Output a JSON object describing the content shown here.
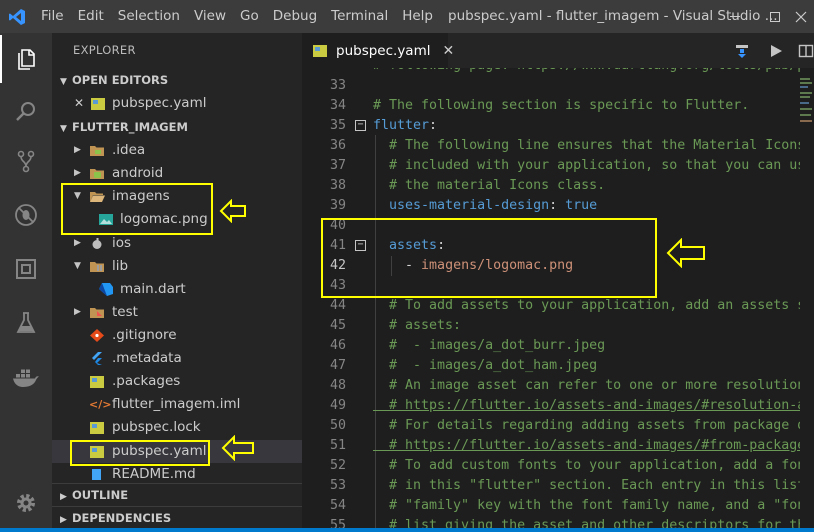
{
  "window": {
    "title": "pubspec.yaml - flutter_imagem - Visual Studio ...",
    "menu": [
      "File",
      "Edit",
      "Selection",
      "View",
      "Go",
      "Debug",
      "Terminal",
      "Help"
    ]
  },
  "activity_bar": [
    "explorer-icon",
    "search-icon",
    "source-control-icon",
    "debug-icon",
    "extensions-icon",
    "test-icon",
    "docker-icon",
    "gear-icon"
  ],
  "sidebar": {
    "title": "EXPLORER",
    "open_editors": {
      "header": "OPEN EDITORS",
      "items": [
        {
          "label": "pubspec.yaml",
          "close": "✕"
        }
      ]
    },
    "project": {
      "header": "FLUTTER_IMAGEM",
      "items": [
        {
          "label": ".idea",
          "type": "folder",
          "expanded": false
        },
        {
          "label": "android",
          "type": "folder",
          "expanded": false
        },
        {
          "label": "imagens",
          "type": "folder",
          "expanded": true
        },
        {
          "label": "logomac.png",
          "type": "image"
        },
        {
          "label": "ios",
          "type": "folder",
          "expanded": false
        },
        {
          "label": "lib",
          "type": "folder",
          "expanded": true
        },
        {
          "label": "main.dart",
          "type": "dart"
        },
        {
          "label": "test",
          "type": "folder",
          "expanded": false
        },
        {
          "label": ".gitignore",
          "type": "git"
        },
        {
          "label": ".metadata",
          "type": "flutter"
        },
        {
          "label": ".packages",
          "type": "yaml"
        },
        {
          "label": "flutter_imagem.iml",
          "type": "xml"
        },
        {
          "label": "pubspec.lock",
          "type": "yaml"
        },
        {
          "label": "pubspec.yaml",
          "type": "yaml",
          "selected": true
        },
        {
          "label": "README.md",
          "type": "md"
        }
      ]
    },
    "outline": {
      "header": "OUTLINE"
    },
    "dependencies": {
      "header": "DEPENDENCIES"
    }
  },
  "editor": {
    "tab": {
      "label": "pubspec.yaml",
      "close": "✕"
    },
    "top_partial": "# following page: https://www.dartlang.org/tools/pub/pubspec",
    "lines": [
      {
        "n": "33",
        "text": ""
      },
      {
        "n": "34",
        "text": "# The following section is specific to Flutter."
      },
      {
        "n": "35",
        "text": "flutter:"
      },
      {
        "n": "36",
        "text": "  # The following line ensures that the Material Icons font is"
      },
      {
        "n": "37",
        "text": "  # included with your application, so that you can use the icons in"
      },
      {
        "n": "38",
        "text": "  # the material Icons class."
      },
      {
        "n": "39",
        "text": "  uses-material-design: true"
      },
      {
        "n": "40",
        "text": ""
      },
      {
        "n": "41",
        "text": "  assets:"
      },
      {
        "n": "42",
        "text": "    - imagens/logomac.png"
      },
      {
        "n": "43",
        "text": ""
      },
      {
        "n": "44",
        "text": "  # To add assets to your application, add an assets section, like this:"
      },
      {
        "n": "45",
        "text": "  # assets:"
      },
      {
        "n": "46",
        "text": "  #  - images/a_dot_burr.jpeg"
      },
      {
        "n": "47",
        "text": "  #  - images/a_dot_ham.jpeg"
      },
      {
        "n": "48",
        "text": "  # An image asset can refer to one or more resolution-specific \"variants\", see"
      },
      {
        "n": "49",
        "text": "  # https://flutter.io/assets-and-images/#resolution-aware."
      },
      {
        "n": "50",
        "text": "  # For details regarding adding assets from package dependencies, see"
      },
      {
        "n": "51",
        "text": "  # https://flutter.io/assets-and-images/#from-packages"
      },
      {
        "n": "52",
        "text": "  # To add custom fonts to your application, add a fonts section here,"
      },
      {
        "n": "53",
        "text": "  # in this \"flutter\" section. Each entry in this list should have a"
      },
      {
        "n": "54",
        "text": "  # \"family\" key with the font family name, and a \"fonts\" key with a"
      },
      {
        "n": "55",
        "text": "  # list giving the asset and other descriptors for the font. For"
      }
    ],
    "yaml_parts": {
      "flutter_key": "flutter",
      "umd_key": "uses-material-design",
      "umd_value": "true",
      "assets_key": "assets",
      "asset_dash": "- ",
      "asset_value": "imagens/logomac.png",
      "colon": ":"
    }
  },
  "colors": {
    "annotation": "#ffff00",
    "accent": "#007acc"
  }
}
